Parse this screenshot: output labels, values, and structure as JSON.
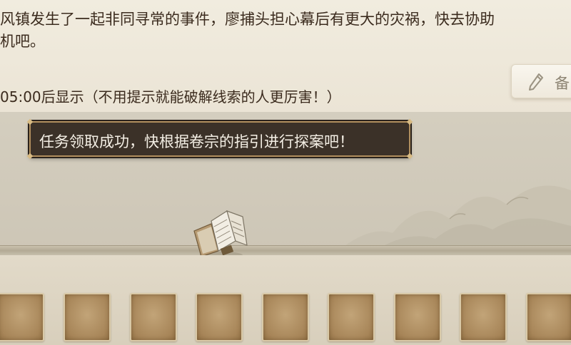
{
  "task": {
    "description": "风镇发生了一起非同寻常的事件，廖捕头担心幕后有更大的灾祸，快去协助\n机吧。",
    "hint_timer": "05:00后显示（不用提示就能破解线索的人更厉害！）"
  },
  "notes_button": {
    "label": "备",
    "icon": "pencil-icon"
  },
  "toast": {
    "message": "任务领取成功，快根据卷宗的指引进行探案吧！"
  },
  "scene": {
    "dossier_icon": "case-file-icon"
  },
  "inventory": {
    "slot_count": 9
  },
  "colors": {
    "parchment": "#e9e2d3",
    "scene_bg": "#d0c9b9",
    "toast_bg": "#3b3128",
    "toast_border": "#b18f5e",
    "slot_fill": "#a78558"
  }
}
